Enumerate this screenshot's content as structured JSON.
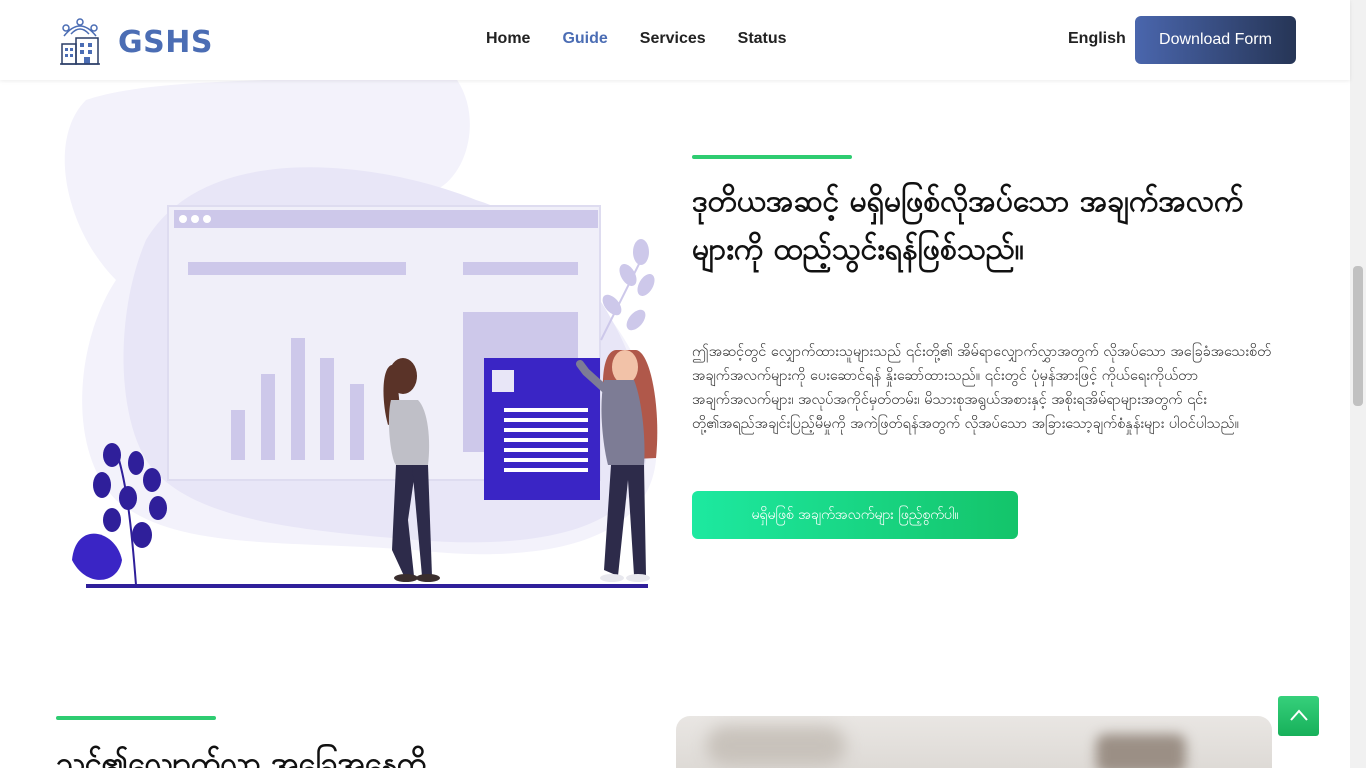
{
  "header": {
    "brand": "GSHS",
    "logo_icon": "building-network-icon",
    "nav": [
      {
        "label": "Home",
        "active": false
      },
      {
        "label": "Guide",
        "active": true
      },
      {
        "label": "Services",
        "active": false
      },
      {
        "label": "Status",
        "active": false
      }
    ],
    "language": "English",
    "download_label": "Download Form"
  },
  "hero": {
    "title_bold": "ဒုတိယအဆင့်",
    "title_rest": " မရှိမဖြစ်လိုအပ်သော အချက်အလက်များကို ထည့်သွင်းရန်ဖြစ်သည်။",
    "description": "ဤအဆင့်တွင် လျှောက်ထားသူများသည် ၎င်းတို့၏ အိမ်ရာလျှောက်လွှာအတွက် လိုအပ်သော အခြေခံအသေးစိတ်အချက်အလက်များကို ပေးဆောင်ရန် နှိုးဆော်ထားသည်။ ၎င်းတွင် ပုံမှန်အားဖြင့် ကိုယ်ရေးကိုယ်တာအချက်အလက်များ၊ အလုပ်အကိုင်မှတ်တမ်း၊ မိသားစုအရွယ်အစားနှင့် အစိုးရအိမ်ရာများအတွက် ၎င်းတို့၏အရည်အချင်းပြည့်မီမှုကို အကဲဖြတ်ရန်အတွက် လိုအပ်သော အခြားသော့ချက်စံနှုန်းများ ပါဝင်ပါသည်။",
    "cta_label": "မရှိမဖြစ် အချက်အလက်များ ဖြည့်စွက်ပါ။",
    "accent_color": "#2ecc71"
  },
  "section2": {
    "title_bold": "သင့်၏လျှောက်လွှာ",
    "title_rest": " အခြေအနေကို"
  },
  "back_to_top_icon": "chevron-up-icon"
}
